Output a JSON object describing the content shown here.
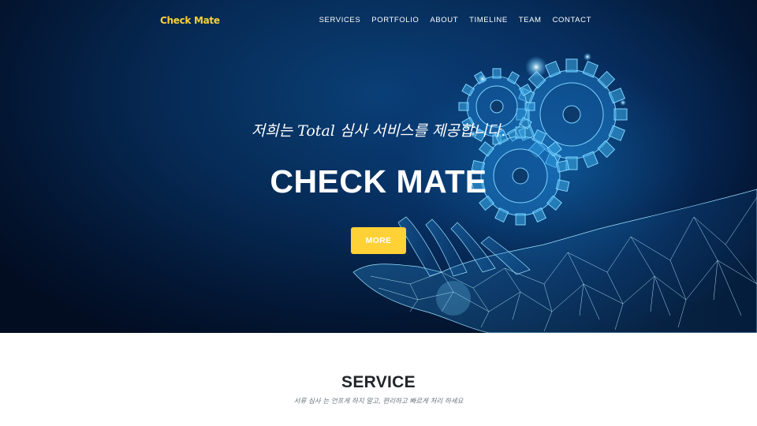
{
  "colors": {
    "accent": "#fed136",
    "hero_dark": "#031633",
    "hero_glow": "#1478c8",
    "text_dark": "#212529",
    "text_muted": "#6c757d"
  },
  "navbar": {
    "brand": "Check Mate",
    "links": [
      {
        "label": "SERVICES"
      },
      {
        "label": "PORTFOLIO"
      },
      {
        "label": "ABOUT"
      },
      {
        "label": "TIMELINE"
      },
      {
        "label": "TEAM"
      },
      {
        "label": "CONTACT"
      }
    ]
  },
  "hero": {
    "subtitle": "저희는 Total 심사 서비스를 제공합니다.",
    "title": "CHECK MATE",
    "button_label": "MORE",
    "image_icons": [
      "gears-icon",
      "hand-icon"
    ]
  },
  "service": {
    "heading": "SERVICE",
    "subheading": "서류 심사 는 언프게 하지 말고, 편리하고 빠르게 처리 하세요"
  }
}
